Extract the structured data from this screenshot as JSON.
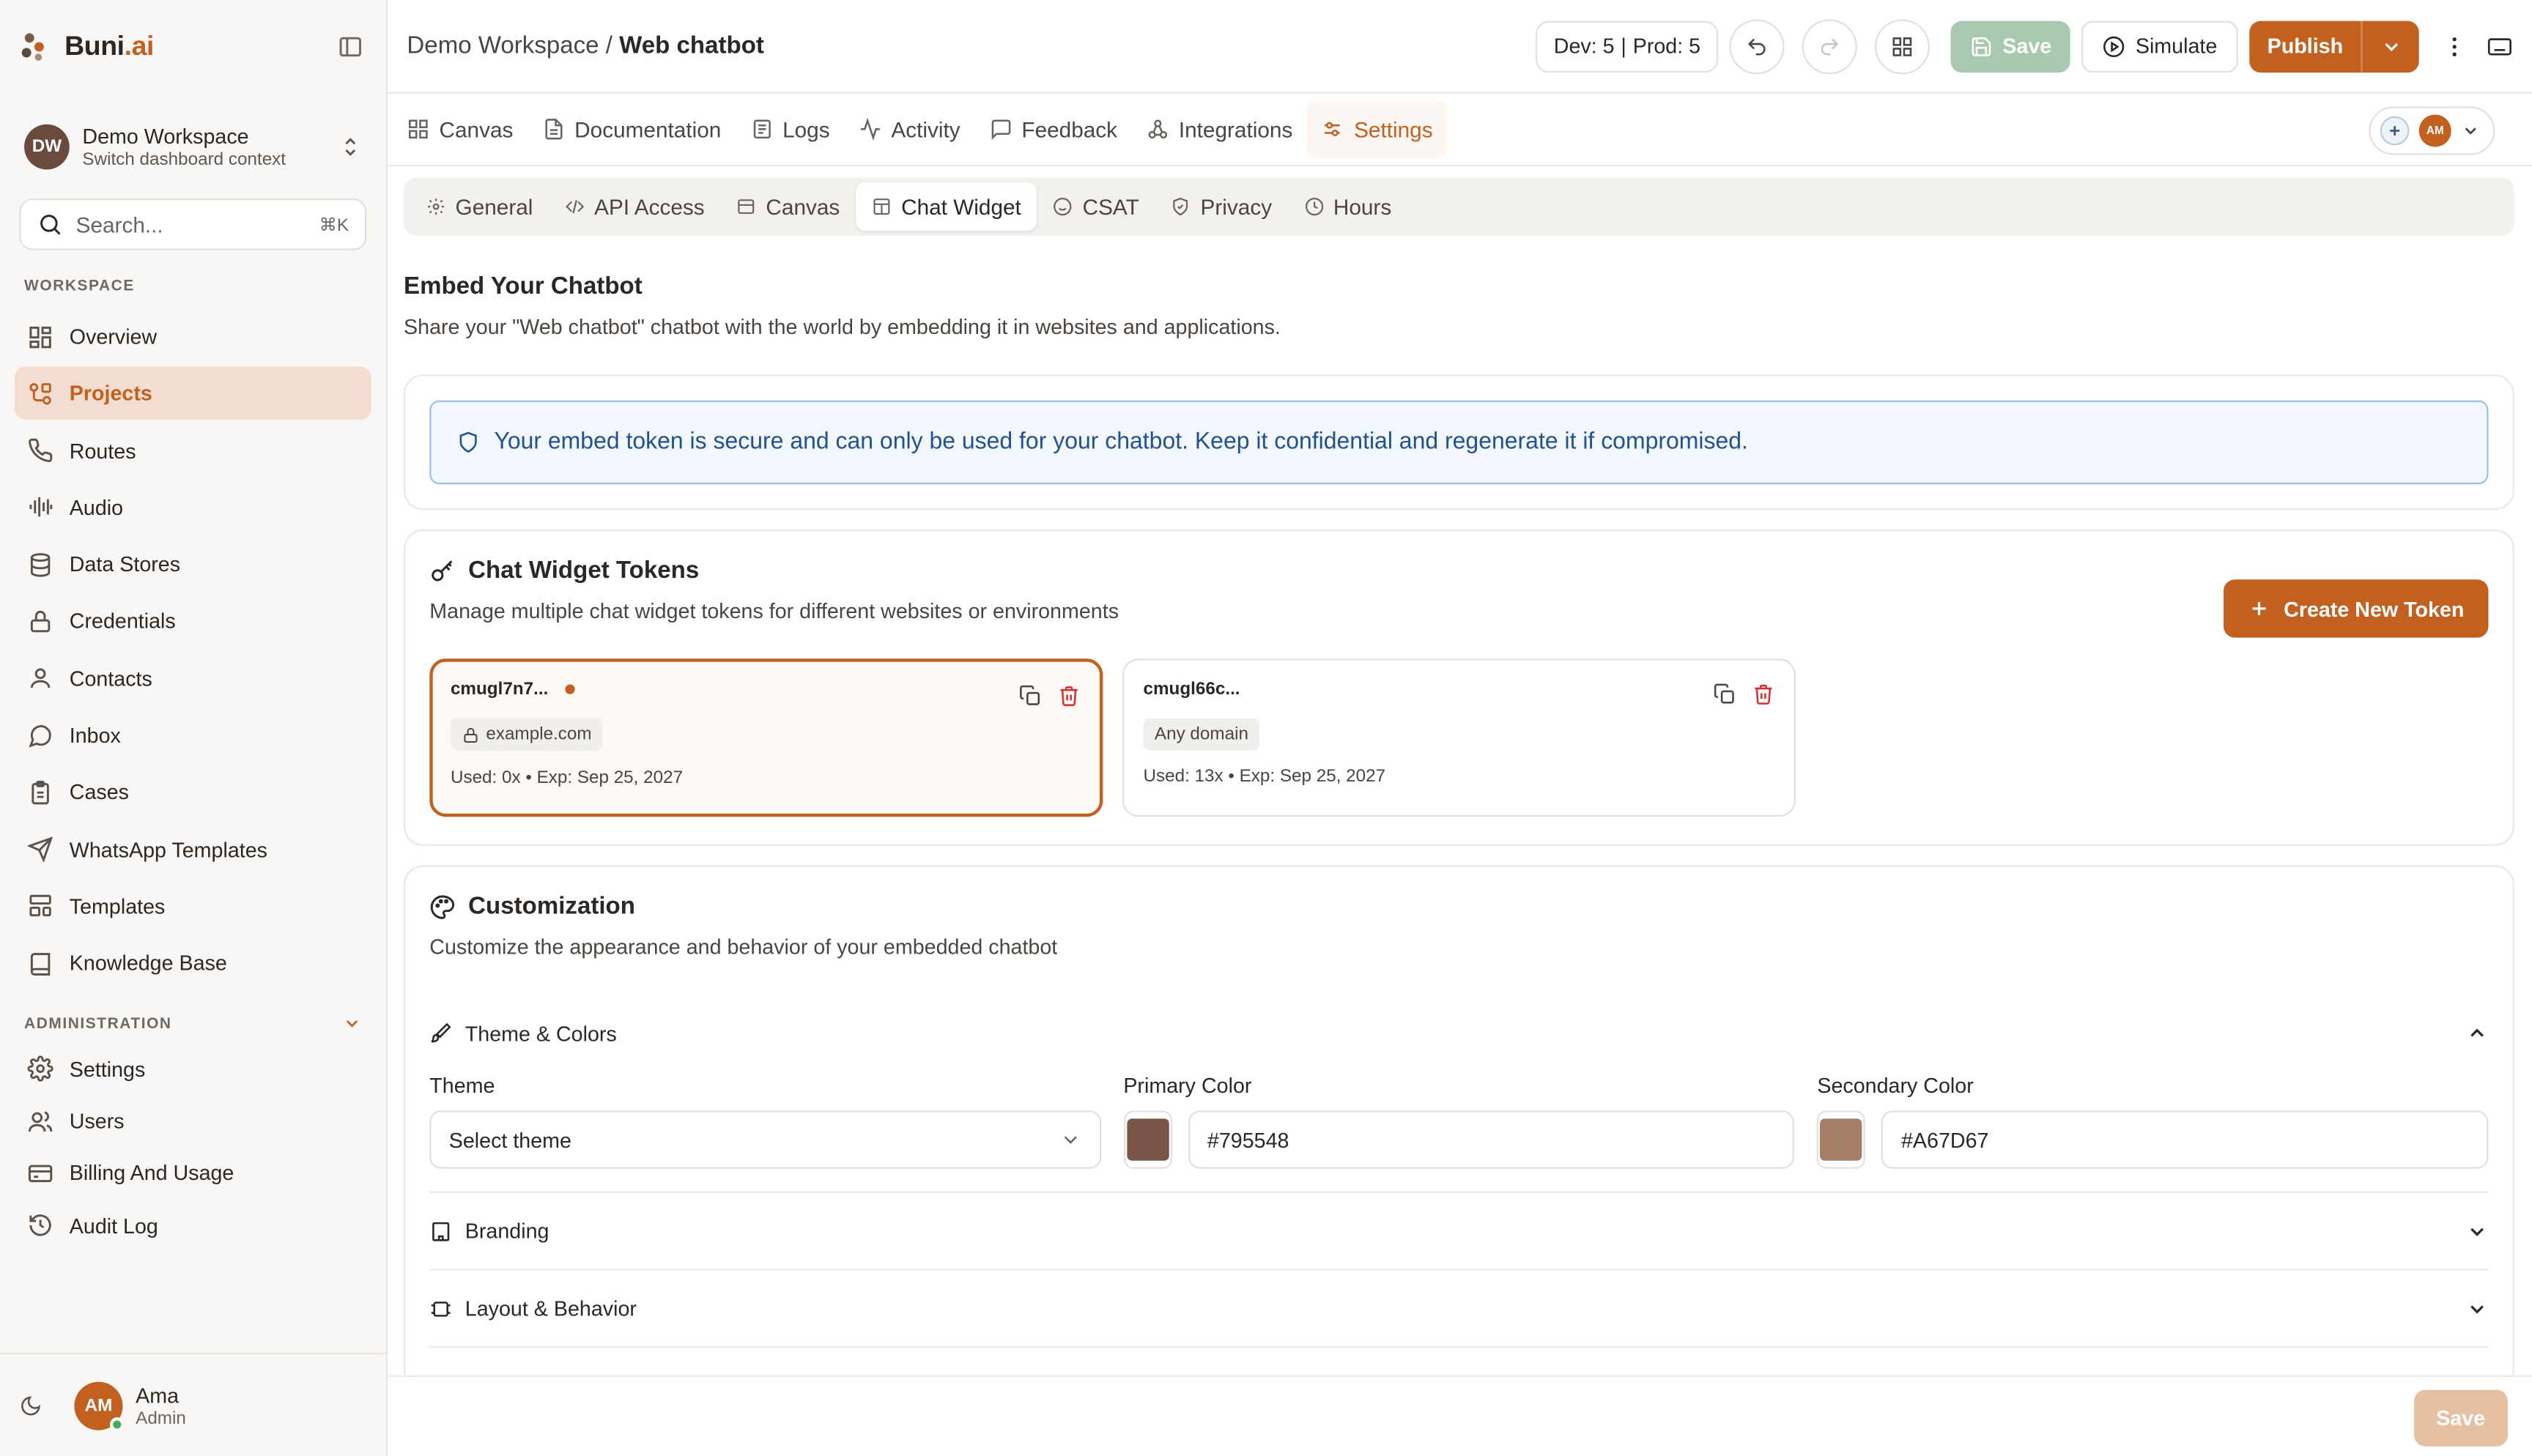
{
  "brand": {
    "name_main": "Buni",
    "name_suffix": ".ai"
  },
  "workspace": {
    "initials": "DW",
    "name": "Demo Workspace",
    "subtitle": "Switch dashboard context"
  },
  "search": {
    "placeholder": "Search...",
    "shortcut": "⌘K"
  },
  "sidebar": {
    "workspace_label": "WORKSPACE",
    "items": [
      {
        "label": "Overview",
        "icon": "overview-icon"
      },
      {
        "label": "Projects",
        "icon": "projects-icon",
        "active": true
      },
      {
        "label": "Routes",
        "icon": "phone-icon"
      },
      {
        "label": "Audio",
        "icon": "audio-waveform-icon"
      },
      {
        "label": "Data Stores",
        "icon": "database-icon"
      },
      {
        "label": "Credentials",
        "icon": "lock-icon"
      },
      {
        "label": "Contacts",
        "icon": "user-icon"
      },
      {
        "label": "Inbox",
        "icon": "chat-bubble-icon"
      },
      {
        "label": "Cases",
        "icon": "clipboard-icon"
      },
      {
        "label": "WhatsApp Templates",
        "icon": "send-icon"
      },
      {
        "label": "Templates",
        "icon": "layout-icon"
      },
      {
        "label": "Knowledge Base",
        "icon": "book-icon"
      }
    ],
    "admin_label": "ADMINISTRATION",
    "admin_items": [
      {
        "label": "Settings",
        "icon": "gear-icon"
      },
      {
        "label": "Users",
        "icon": "users-icon"
      },
      {
        "label": "Billing And Usage",
        "icon": "wallet-icon"
      },
      {
        "label": "Audit Log",
        "icon": "history-icon"
      }
    ]
  },
  "user": {
    "initials": "AM",
    "name": "Ama",
    "role": "Admin"
  },
  "topbar": {
    "breadcrumb_parent": "Demo Workspace",
    "breadcrumb_sep": " / ",
    "breadcrumb_current": "Web chatbot",
    "env_dev": "Dev: 5",
    "env_prod": "Prod: 5",
    "save_label": "Save",
    "simulate_label": "Simulate",
    "publish_label": "Publish"
  },
  "tabs": [
    {
      "label": "Canvas",
      "icon": "grid-icon"
    },
    {
      "label": "Documentation",
      "icon": "document-icon"
    },
    {
      "label": "Logs",
      "icon": "logs-icon"
    },
    {
      "label": "Activity",
      "icon": "activity-icon"
    },
    {
      "label": "Feedback",
      "icon": "message-square-icon"
    },
    {
      "label": "Integrations",
      "icon": "webhook-icon"
    },
    {
      "label": "Settings",
      "icon": "sliders-icon",
      "active": true
    }
  ],
  "collaborator_initials": "AM",
  "subtabs": [
    {
      "label": "General",
      "icon": "gear-icon"
    },
    {
      "label": "API Access",
      "icon": "code-icon"
    },
    {
      "label": "Canvas",
      "icon": "panel-icon"
    },
    {
      "label": "Chat Widget",
      "icon": "widget-icon",
      "active": true
    },
    {
      "label": "CSAT",
      "icon": "smile-icon"
    },
    {
      "label": "Privacy",
      "icon": "shield-check-icon"
    },
    {
      "label": "Hours",
      "icon": "clock-icon"
    }
  ],
  "embed": {
    "title": "Embed Your Chatbot",
    "description": "Share your \"Web chatbot\" chatbot with the world by embedding it in websites and applications.",
    "notice": "Your embed token is secure and can only be used for your chatbot. Keep it confidential and regenerate it if compromised."
  },
  "tokens_section": {
    "title": "Chat Widget Tokens",
    "description": "Manage multiple chat widget tokens for different websites or environments",
    "create_label": "Create New Token",
    "tokens": [
      {
        "id": "cmugl7n7...",
        "domain": "example.com",
        "meta": "Used: 0x • Exp: Sep 25, 2027",
        "selected": true
      },
      {
        "id": "cmugl66c...",
        "domain": "Any domain",
        "meta": "Used: 13x • Exp: Sep 25, 2027",
        "selected": false
      }
    ]
  },
  "customization": {
    "title": "Customization",
    "description": "Customize the appearance and behavior of your embedded chatbot",
    "theme_section": "Theme & Colors",
    "theme_label": "Theme",
    "theme_value": "Select theme",
    "primary_label": "Primary Color",
    "primary_value": "#795548",
    "secondary_label": "Secondary Color",
    "secondary_value": "#A67D67",
    "branding_label": "Branding",
    "layout_label": "Layout & Behavior"
  },
  "footer": {
    "save_label": "Save"
  },
  "colors": {
    "accent": "#c2601f",
    "primary_swatch": "#795548",
    "secondary_swatch": "#A67D67",
    "notice_text": "#23518f"
  }
}
